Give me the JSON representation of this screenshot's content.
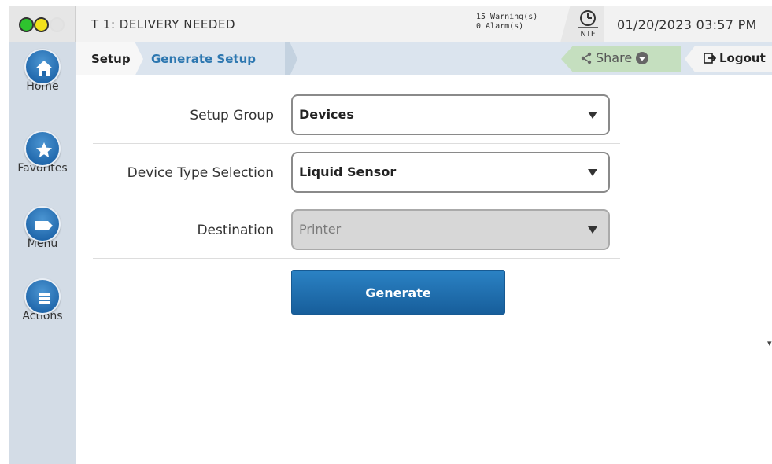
{
  "status": {
    "title": "T 1: DELIVERY NEEDED",
    "warnings": "15 Warning(s)",
    "alarms": "0 Alarm(s)",
    "ntf_label": "NTF",
    "datetime": "01/20/2023 03:57 PM",
    "lights": [
      "green",
      "yellow",
      "off"
    ],
    "colors": {
      "green": "#2ec32e",
      "yellow": "#f3e21c"
    }
  },
  "sidebar": {
    "items": [
      {
        "label": "Home",
        "icon": "home-icon"
      },
      {
        "label": "Favorites",
        "icon": "star-icon"
      },
      {
        "label": "Menu",
        "icon": "tag-icon"
      },
      {
        "label": "Actions",
        "icon": "list-icon"
      }
    ]
  },
  "breadcrumb": {
    "setup": "Setup",
    "current": "Generate Setup"
  },
  "toolbar": {
    "share": "Share",
    "logout": "Logout"
  },
  "form": {
    "setup_group": {
      "label": "Setup Group",
      "value": "Devices"
    },
    "device_type": {
      "label": "Device Type Selection",
      "value": "Liquid Sensor"
    },
    "destination": {
      "label": "Destination",
      "value": "Printer",
      "disabled": true
    },
    "generate": "Generate"
  },
  "colors": {
    "accent": "#2067ab",
    "sidebar_bg": "#d3dce6",
    "share_bg": "#c5dfbf"
  }
}
